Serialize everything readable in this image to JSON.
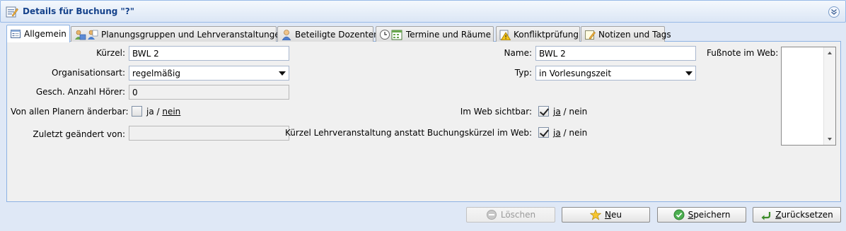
{
  "window": {
    "title": "Details für Buchung \"?\""
  },
  "tabs": [
    {
      "label": "Allgemein"
    },
    {
      "label": "Planungsgruppen und Lehrveranstaltungen"
    },
    {
      "label": "Beteiligte Dozenten"
    },
    {
      "label": "Termine und Räume"
    },
    {
      "label": "Konfliktprüfung"
    },
    {
      "label": "Notizen und Tags"
    }
  ],
  "form": {
    "kuerzel": {
      "label": "Kürzel:",
      "value": "BWL 2"
    },
    "organisationsart": {
      "label": "Organisationsart:",
      "value": "regelmäßig"
    },
    "hoerer": {
      "label": "Gesch. Anzahl Hörer:",
      "value": "0"
    },
    "aenderbar": {
      "label": "Von allen Planern änderbar:",
      "checked": false,
      "yes": "ja",
      "sep": " / ",
      "no": "nein"
    },
    "zuletzt": {
      "label": "Zuletzt geändert von:",
      "value": ""
    },
    "name": {
      "label": "Name:",
      "value": "BWL 2"
    },
    "typ": {
      "label": "Typ:",
      "value": "in Vorlesungszeit"
    },
    "web_sichtbar": {
      "label": "Im Web sichtbar:",
      "checked": true,
      "yes": "ja",
      "sep": " / ",
      "no": "nein"
    },
    "kuerzel_lv": {
      "label": "Kürzel Lehrveranstaltung anstatt Buchungskürzel im Web:",
      "checked": true,
      "yes": "ja",
      "sep": " / ",
      "no": "nein"
    },
    "fussnote": {
      "label": "Fußnote im Web:",
      "value": ""
    }
  },
  "buttons": {
    "loeschen": "Löschen",
    "neu_u": "N",
    "neu_rest": "eu",
    "speichern_u": "S",
    "speichern_rest": "peichern",
    "zurueck_u": "Z",
    "zurueck_rest": "urücksetzen"
  },
  "colors": {
    "title": "#15428b",
    "tab_border": "#8db2e3",
    "panel_bg": "#f0f0f0"
  }
}
